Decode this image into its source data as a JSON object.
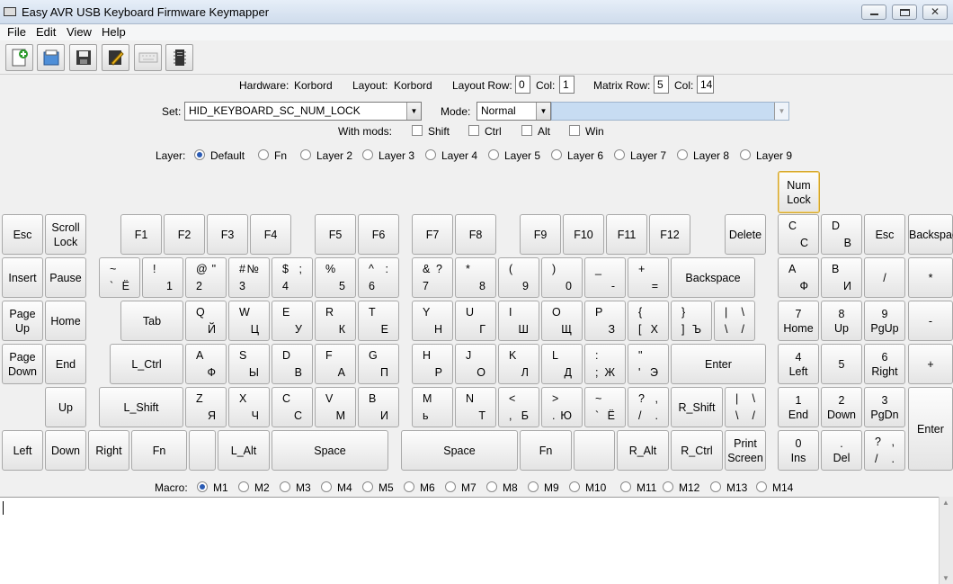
{
  "window": {
    "title": "Easy AVR USB Keyboard Firmware Keymapper"
  },
  "menu": [
    "File",
    "Edit",
    "View",
    "Help"
  ],
  "toolbar_icons": [
    "new-icon",
    "open-icon",
    "save-icon",
    "edit-icon",
    "keyboard-icon",
    "chip-icon"
  ],
  "info": {
    "hardware_label": "Hardware:",
    "hardware": "Korbord",
    "layout_label": "Layout:",
    "layout": "Korbord",
    "layout_row_label": "Layout Row:",
    "layout_row": "0",
    "col_label": "Col:",
    "layout_col": "1",
    "matrix_row_label": "Matrix Row:",
    "matrix_row": "5",
    "matrix_col_label": "Col:",
    "matrix_col": "14"
  },
  "set": {
    "label": "Set:",
    "value": "HID_KEYBOARD_SC_NUM_LOCK"
  },
  "mode": {
    "label": "Mode:",
    "value": "Normal"
  },
  "mods": {
    "label": "With mods:",
    "items": [
      "Shift",
      "Ctrl",
      "Alt",
      "Win"
    ]
  },
  "layers": {
    "label": "Layer:",
    "items": [
      "Default",
      "Fn",
      "Layer 2",
      "Layer 3",
      "Layer 4",
      "Layer 5",
      "Layer 6",
      "Layer 7",
      "Layer 8",
      "Layer 9"
    ],
    "selected": 0
  },
  "macros": {
    "label": "Macro:",
    "items": [
      "M1",
      "M2",
      "M3",
      "M4",
      "M5",
      "M6",
      "M7",
      "M8",
      "M9",
      "M10",
      "M11",
      "M12",
      "M13",
      "M14"
    ],
    "selected": 0
  },
  "keys": [
    {
      "id": "numlock",
      "c": "Num\nLock",
      "sel": true
    },
    {
      "id": "esc",
      "c": "Esc"
    },
    {
      "id": "scrolllock",
      "c": "Scroll\nLock"
    },
    {
      "id": "f1",
      "c": "F1"
    },
    {
      "id": "f2",
      "c": "F2"
    },
    {
      "id": "f3",
      "c": "F3"
    },
    {
      "id": "f4",
      "c": "F4"
    },
    {
      "id": "f5",
      "c": "F5"
    },
    {
      "id": "f6",
      "c": "F6"
    },
    {
      "id": "f7",
      "c": "F7"
    },
    {
      "id": "f8",
      "c": "F8"
    },
    {
      "id": "f9",
      "c": "F9"
    },
    {
      "id": "f10",
      "c": "F10"
    },
    {
      "id": "f11",
      "c": "F11"
    },
    {
      "id": "f12",
      "c": "F12"
    },
    {
      "id": "delete",
      "c": "Delete"
    },
    {
      "id": "np-c",
      "tl": "C",
      "br": "С"
    },
    {
      "id": "np-d",
      "tl": "D",
      "br": "В"
    },
    {
      "id": "np-esc",
      "c": "Esc"
    },
    {
      "id": "np-backspace",
      "c": "Backspace"
    },
    {
      "id": "insert",
      "c": "Insert"
    },
    {
      "id": "pause",
      "c": "Pause"
    },
    {
      "id": "tilde",
      "tl": "~",
      "bl": "`",
      "br": "Ё"
    },
    {
      "id": "k1",
      "tl": "!",
      "br": "1"
    },
    {
      "id": "k2",
      "tl": "@",
      "tr": "\"",
      "bl": "2"
    },
    {
      "id": "k3",
      "tl": "#",
      "tr": "№",
      "bl": "3"
    },
    {
      "id": "k4",
      "tl": "$",
      "tr": ";",
      "bl": "4"
    },
    {
      "id": "k5",
      "tl": "%",
      "br": "5"
    },
    {
      "id": "k6",
      "tl": "^",
      "tr": ":",
      "bl": "6"
    },
    {
      "id": "k7",
      "tl": "&",
      "tr": "?",
      "bl": "7"
    },
    {
      "id": "k8",
      "tl": "*",
      "br": "8"
    },
    {
      "id": "k9",
      "tl": "(",
      "br": "9"
    },
    {
      "id": "k0",
      "tl": ")",
      "br": "0"
    },
    {
      "id": "minus",
      "tl": "_",
      "br": "-"
    },
    {
      "id": "equal",
      "tl": "+",
      "br": "="
    },
    {
      "id": "backspace",
      "c": "Backspace"
    },
    {
      "id": "np-a",
      "tl": "A",
      "br": "Ф"
    },
    {
      "id": "np-b",
      "tl": "B",
      "br": "И"
    },
    {
      "id": "np-slash",
      "c": "/"
    },
    {
      "id": "np-star",
      "c": "*"
    },
    {
      "id": "pageup",
      "c": "Page\nUp"
    },
    {
      "id": "home",
      "c": "Home"
    },
    {
      "id": "tab",
      "c": "Tab"
    },
    {
      "id": "q",
      "tl": "Q",
      "br": "Й"
    },
    {
      "id": "w",
      "tl": "W",
      "br": "Ц"
    },
    {
      "id": "e",
      "tl": "E",
      "br": "У"
    },
    {
      "id": "r",
      "tl": "R",
      "br": "К"
    },
    {
      "id": "t",
      "tl": "T",
      "br": "Е"
    },
    {
      "id": "y",
      "tl": "Y",
      "br": "Н"
    },
    {
      "id": "u",
      "tl": "U",
      "br": "Г"
    },
    {
      "id": "i",
      "tl": "I",
      "br": "Ш"
    },
    {
      "id": "o",
      "tl": "O",
      "br": "Щ"
    },
    {
      "id": "p",
      "tl": "P",
      "br": "З"
    },
    {
      "id": "lbracket",
      "tl": "{",
      "br": "Х",
      "bl": "["
    },
    {
      "id": "rbracket",
      "tl": "}",
      "bl": "]",
      "br": "Ъ"
    },
    {
      "id": "backslash",
      "tl": "|",
      "tr": "\\",
      "bl": "\\",
      "br": "/"
    },
    {
      "id": "np7",
      "c": "7\nHome"
    },
    {
      "id": "np8",
      "c": "8\nUp"
    },
    {
      "id": "np9",
      "c": "9\nPgUp"
    },
    {
      "id": "np-minus",
      "c": "-"
    },
    {
      "id": "pagedown",
      "c": "Page\nDown"
    },
    {
      "id": "end",
      "c": "End"
    },
    {
      "id": "lctrl",
      "c": "L_Ctrl"
    },
    {
      "id": "a",
      "tl": "A",
      "br": "Ф"
    },
    {
      "id": "s",
      "tl": "S",
      "br": "Ы"
    },
    {
      "id": "d",
      "tl": "D",
      "br": "В"
    },
    {
      "id": "f",
      "tl": "F",
      "br": "А"
    },
    {
      "id": "g",
      "tl": "G",
      "br": "П"
    },
    {
      "id": "h",
      "tl": "H",
      "br": "Р"
    },
    {
      "id": "j",
      "tl": "J",
      "br": "О"
    },
    {
      "id": "k",
      "tl": "K",
      "br": "Л"
    },
    {
      "id": "l",
      "tl": "L",
      "br": "Д"
    },
    {
      "id": "semicolon",
      "tl": ":",
      "bl": ";",
      "br": "Ж"
    },
    {
      "id": "quote",
      "tl": "\"",
      "bl": "'",
      "br": "Э"
    },
    {
      "id": "enter",
      "c": "Enter"
    },
    {
      "id": "np4",
      "c": "4\nLeft"
    },
    {
      "id": "np5",
      "c": "5"
    },
    {
      "id": "np6",
      "c": "6\nRight"
    },
    {
      "id": "np-plus",
      "c": "+"
    },
    {
      "id": "up",
      "c": "Up"
    },
    {
      "id": "lshift",
      "c": "L_Shift"
    },
    {
      "id": "z",
      "tl": "Z",
      "br": "Я"
    },
    {
      "id": "x",
      "tl": "X",
      "br": "Ч"
    },
    {
      "id": "cc",
      "tl": "C",
      "br": "С"
    },
    {
      "id": "v",
      "tl": "V",
      "br": "М"
    },
    {
      "id": "b",
      "tl": "B",
      "br": "И"
    },
    {
      "id": "m",
      "tl": "M",
      "bl": "ь"
    },
    {
      "id": "n",
      "tl": "N",
      "br": "Т"
    },
    {
      "id": "comma",
      "tl": "<",
      "bl": ",",
      "br": "Б"
    },
    {
      "id": "period",
      "tl": ">",
      "bl": ".",
      "br": "Ю"
    },
    {
      "id": "grave2",
      "tl": "~",
      "bl": "`",
      "br": "Ё"
    },
    {
      "id": "slash",
      "tl": "?",
      "tr": ",",
      "bl": "/",
      "br": "."
    },
    {
      "id": "rshift",
      "c": "R_Shift"
    },
    {
      "id": "backslash2",
      "tl": "|",
      "tr": "\\",
      "bl": "\\",
      "br": "/"
    },
    {
      "id": "np1",
      "c": "1\nEnd"
    },
    {
      "id": "np2",
      "c": "2\nDown"
    },
    {
      "id": "np3",
      "c": "3\nPgDn"
    },
    {
      "id": "np-enter",
      "c": "Enter"
    },
    {
      "id": "left",
      "c": "Left"
    },
    {
      "id": "down",
      "c": "Down"
    },
    {
      "id": "right",
      "c": "Right"
    },
    {
      "id": "fn1",
      "c": "Fn"
    },
    {
      "id": "blank1",
      "c": ""
    },
    {
      "id": "lalt",
      "c": "L_Alt"
    },
    {
      "id": "space1",
      "c": "Space"
    },
    {
      "id": "space2",
      "c": "Space"
    },
    {
      "id": "fn2",
      "c": "Fn"
    },
    {
      "id": "blank2",
      "c": ""
    },
    {
      "id": "ralt",
      "c": "R_Alt"
    },
    {
      "id": "rctrl",
      "c": "R_Ctrl"
    },
    {
      "id": "printscreen",
      "c": "Print\nScreen"
    },
    {
      "id": "np0",
      "c": "0\nIns"
    },
    {
      "id": "np-dot",
      "c": ".\nDel"
    },
    {
      "id": "np-qmark",
      "tl": "?",
      "tr": ",",
      "bl": "/",
      "br": "."
    }
  ]
}
